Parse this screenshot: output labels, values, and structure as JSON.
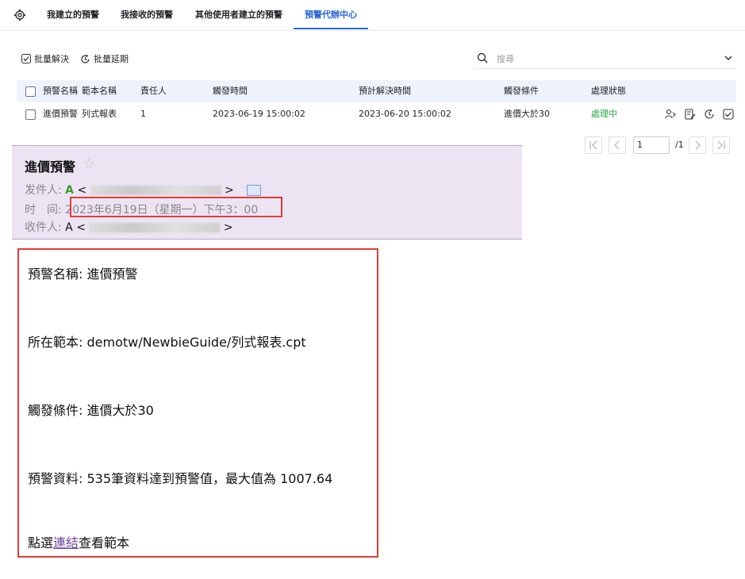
{
  "tabs": {
    "items": [
      "我建立的預警",
      "我接收的預警",
      "其他使用者建立的預警",
      "預警代辦中心"
    ],
    "active_index": 3
  },
  "toolbar": {
    "bulk_resolve": "批量解決",
    "bulk_postpone": "批量延期",
    "search_placeholder": "搜尋"
  },
  "table": {
    "headers": [
      "預警名稱",
      "範本名稱",
      "責任人",
      "觸發時間",
      "預計解決時間",
      "觸發條件",
      "處理狀態"
    ],
    "rows": [
      {
        "name": "進價預警",
        "template": "列式報表",
        "owner": "1",
        "trigger_time": "2023-06-19 15:00:02",
        "expected_time": "2023-06-20 15:00:02",
        "condition": "進價大於30",
        "status": "處理中"
      }
    ],
    "status_color": "#28a745"
  },
  "pagination": {
    "current": "1",
    "total": "/1"
  },
  "mail": {
    "subject": "進價預警",
    "from_label": "发件人:",
    "from_name": "A",
    "time_label": "时　间:",
    "time_value": "2023年6月19日（星期一）下午3：00",
    "to_label": "收件人:",
    "to_name": "A"
  },
  "body": {
    "line1": "預警名稱: 進價預警",
    "line2": "所在範本: demotw/NewbieGuide/列式報表.cpt",
    "line3": "觸發條件: 進價大於30",
    "line4": "預警資料: 535筆資料達到預警值，最大值為 1007.64",
    "line5_pre": "點選",
    "line5_link": "連結",
    "line5_post": "查看範本"
  },
  "colors": {
    "accent": "#2a64d8",
    "highlight_border": "#e03b3b",
    "mail_header_bg": "#ece4f2"
  }
}
